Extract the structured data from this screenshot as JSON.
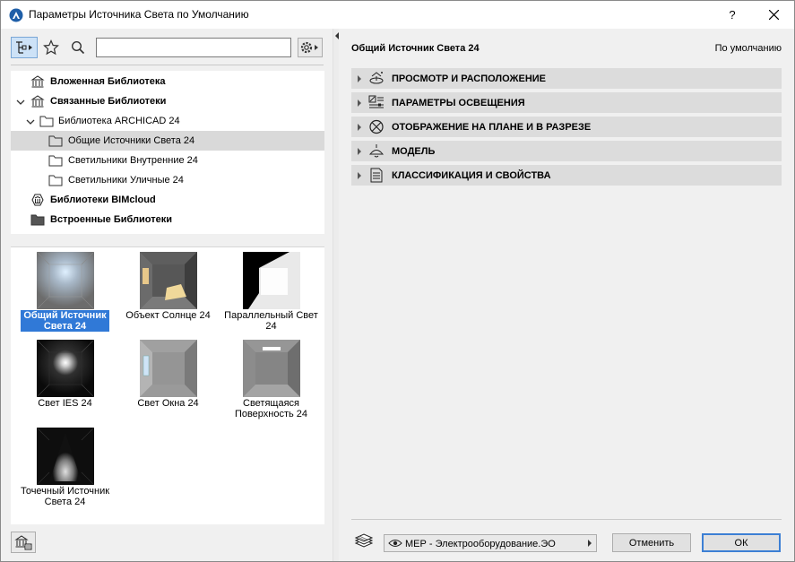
{
  "window": {
    "title": "Параметры Источника Света по Умолчанию",
    "help_label": "?"
  },
  "search": {
    "value": "",
    "placeholder": ""
  },
  "tree": {
    "items": [
      {
        "label": "Вложенная Библиотека",
        "bold": true,
        "icon": "building-icon"
      },
      {
        "label": "Связанные Библиотеки",
        "bold": true,
        "icon": "building-icon",
        "expanded": true
      },
      {
        "label": "Библиотека ARCHICAD 24",
        "bold": false,
        "icon": "folder-icon",
        "expanded": true
      },
      {
        "label": "Общие Источники Света 24",
        "bold": false,
        "icon": "folder-icon",
        "selected": true
      },
      {
        "label": "Светильники Внутренние 24",
        "bold": false,
        "icon": "folder-icon"
      },
      {
        "label": "Светильники Уличные 24",
        "bold": false,
        "icon": "folder-icon"
      },
      {
        "label": "Библиотеки BIMcloud",
        "bold": true,
        "icon": "cloud-library-icon"
      },
      {
        "label": "Встроенные Библиотеки",
        "bold": true,
        "icon": "folder-dark-icon"
      }
    ]
  },
  "thumbnails": {
    "items": [
      {
        "label": "Общий Источник Света 24",
        "selected": true,
        "icon": "general-light-icon"
      },
      {
        "label": "Объект Солнце 24",
        "selected": false,
        "icon": "sun-object-icon"
      },
      {
        "label": "Параллельный Свет 24",
        "selected": false,
        "icon": "parallel-light-icon"
      },
      {
        "label": "Свет IES 24",
        "selected": false,
        "icon": "ies-light-icon"
      },
      {
        "label": "Свет Окна 24",
        "selected": false,
        "icon": "window-light-icon"
      },
      {
        "label": "Светящаяся Поверхность 24",
        "selected": false,
        "icon": "luminous-surface-icon"
      },
      {
        "label": "Точечный Источник Света 24",
        "selected": false,
        "icon": "spot-light-icon"
      }
    ]
  },
  "right": {
    "title": "Общий Источник Света 24",
    "default_label": "По умолчанию",
    "sections": [
      {
        "label": "ПРОСМОТР И РАСПОЛОЖЕНИЕ",
        "icon": "view-placement-icon"
      },
      {
        "label": "ПАРАМЕТРЫ ОСВЕЩЕНИЯ",
        "icon": "light-settings-icon"
      },
      {
        "label": "ОТОБРАЖЕНИЕ НА ПЛАНЕ И В РАЗРЕЗЕ",
        "icon": "plan-section-icon"
      },
      {
        "label": "МОДЕЛЬ",
        "icon": "lamp-model-icon"
      },
      {
        "label": "КЛАССИФИКАЦИЯ И СВОЙСТВА",
        "icon": "classification-icon"
      }
    ]
  },
  "footer": {
    "layer_value": "МЕР - Электрооборудование.ЭО",
    "cancel_label": "Отменить",
    "ok_label": "ОК"
  }
}
